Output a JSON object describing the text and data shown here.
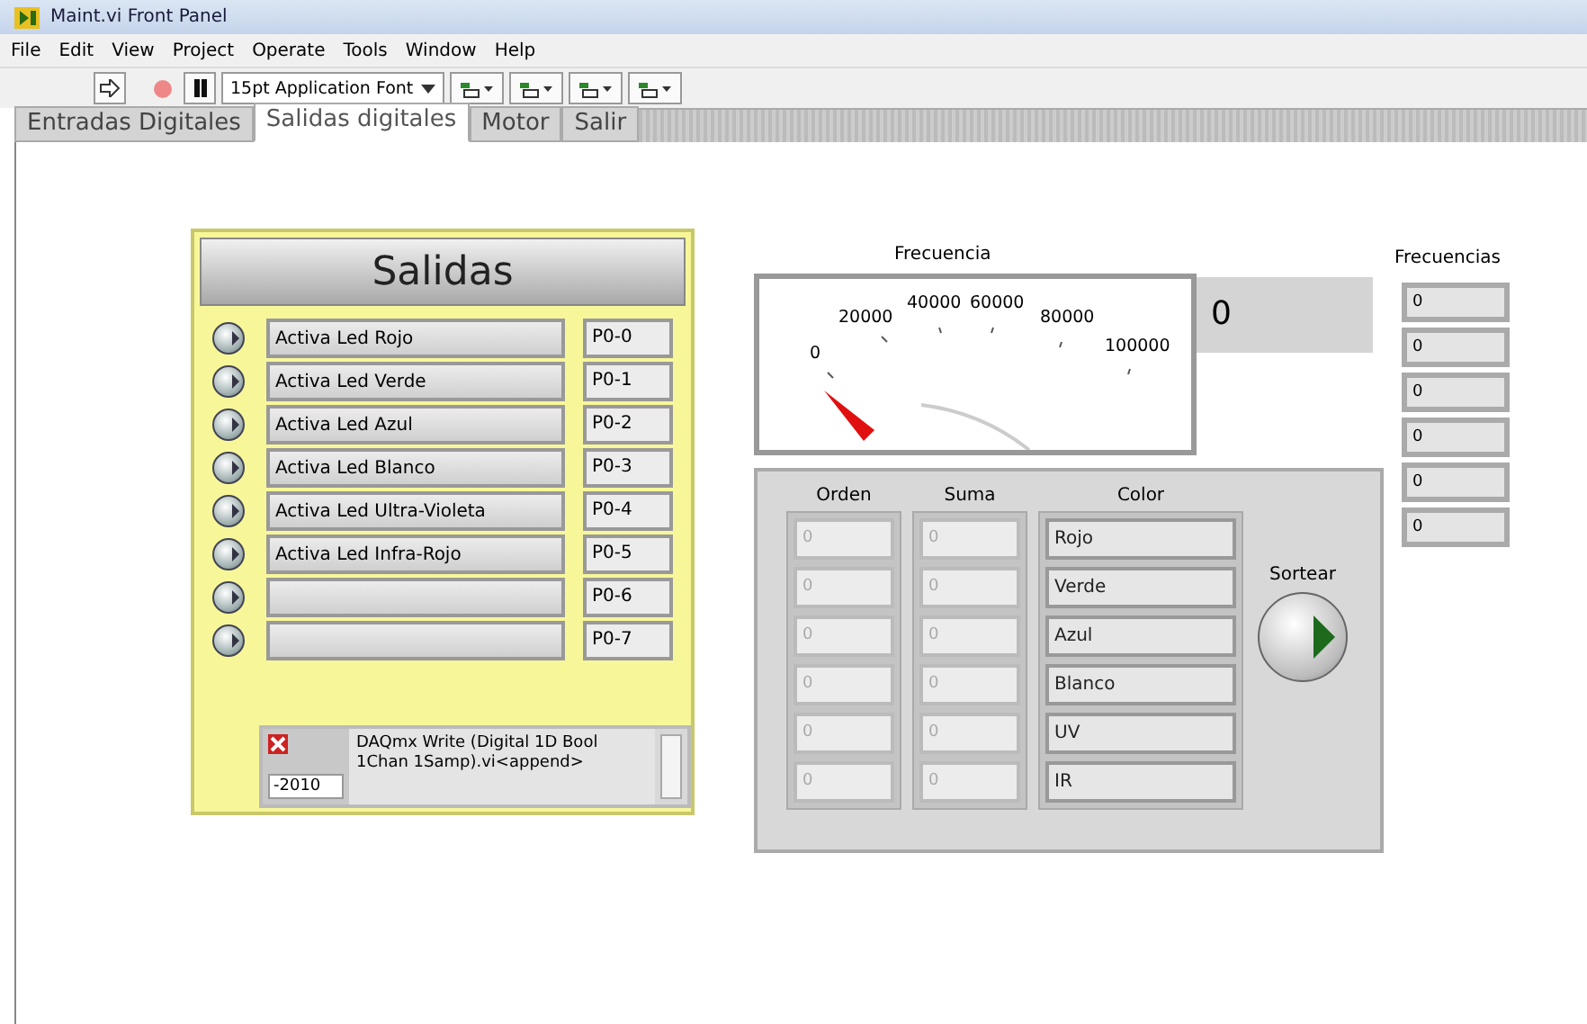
{
  "window": {
    "title": "Maint.vi Front Panel"
  },
  "menu": [
    "File",
    "Edit",
    "View",
    "Project",
    "Operate",
    "Tools",
    "Window",
    "Help"
  ],
  "toolbar": {
    "font": "15pt Application Font"
  },
  "tabs": [
    {
      "label": "Entradas Digitales",
      "selected": false
    },
    {
      "label": "Salidas digitales",
      "selected": true
    },
    {
      "label": "Motor",
      "selected": false
    },
    {
      "label": "Salir",
      "selected": false
    }
  ],
  "salidas": {
    "title": "Salidas",
    "rows": [
      {
        "label": "Activa Led Rojo",
        "line": "P0-0",
        "on": false
      },
      {
        "label": "Activa Led Verde",
        "line": "P0-1",
        "on": false
      },
      {
        "label": "Activa Led Azul",
        "line": "P0-2",
        "on": false
      },
      {
        "label": "Activa Led Blanco",
        "line": "P0-3",
        "on": false
      },
      {
        "label": "Activa Led Ultra-Violeta",
        "line": "P0-4",
        "on": false
      },
      {
        "label": "Activa Led Infra-Rojo",
        "line": "P0-5",
        "on": false
      },
      {
        "label": "",
        "line": "P0-6",
        "on": false
      },
      {
        "label": "",
        "line": "P0-7",
        "on": false
      }
    ],
    "error": {
      "status": true,
      "code": "-2010",
      "source": "DAQmx Write (Digital 1D Bool 1Chan 1Samp).vi<append>"
    }
  },
  "gauge": {
    "label": "Frecuencia",
    "ticks": [
      "0",
      "20000",
      "40000",
      "60000",
      "80000",
      "100000"
    ],
    "reading": "0"
  },
  "frecuencias": {
    "label": "Frecuencias",
    "values": [
      "0",
      "0",
      "0",
      "0",
      "0",
      "0"
    ]
  },
  "sorteo": {
    "orden": {
      "label": "Orden",
      "values": [
        "0",
        "0",
        "0",
        "0",
        "0",
        "0"
      ]
    },
    "suma": {
      "label": "Suma",
      "values": [
        "0",
        "0",
        "0",
        "0",
        "0",
        "0"
      ]
    },
    "color": {
      "label": "Color",
      "values": [
        "Rojo",
        "Verde",
        "Azul",
        "Blanco",
        "UV",
        "IR"
      ]
    },
    "button": {
      "label": "Sortear",
      "on": false
    }
  }
}
